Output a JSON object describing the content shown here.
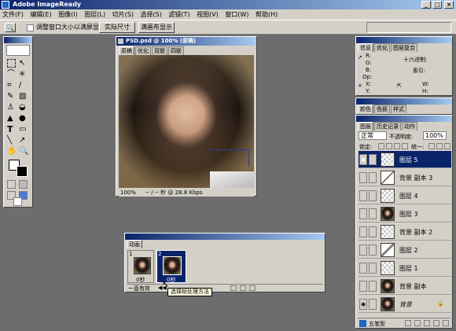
{
  "app": {
    "title": "Adobe ImageReady"
  },
  "window_buttons": [
    "_",
    "□",
    "×"
  ],
  "menu": [
    "文件(F)",
    "编辑(E)",
    "图像(I)",
    "图层(L)",
    "切片(S)",
    "选择(S)",
    "滤镜(T)",
    "视图(V)",
    "窗口(W)",
    "帮助(H)"
  ],
  "options": {
    "checkbox_label": "调整窗口大小以满屏显示",
    "actual_size": "实际尺寸",
    "fit_screen": "满画布显示"
  },
  "doc": {
    "title": "PSD.psd @ 100% (原稿)",
    "tabs": [
      "原稿",
      "优化",
      "双联",
      "四联"
    ],
    "zoom": "100%",
    "status": "-- / -- 秒 @ 28.8 Kbps"
  },
  "info_panel": {
    "tabs": [
      "信息",
      "优化",
      "图层复合"
    ],
    "r": "R:",
    "g": "G:",
    "b": "B:",
    "op": "Op:",
    "hex_label": "十六进制:",
    "index_label": "索引:",
    "x": "X:",
    "y": "Y:",
    "w": "W:",
    "h": "H:"
  },
  "color_panel": {
    "tabs": [
      "颜色",
      "色板",
      "样式"
    ]
  },
  "layers_panel": {
    "tabs": [
      "图层",
      "历史记录",
      "动作"
    ],
    "blend_mode": "正常",
    "opacity_label": "不透明度:",
    "opacity": "100%",
    "lock_label": "锁定:",
    "unify_label": "统一:",
    "layers": [
      {
        "name": "图层 5",
        "selected": true,
        "visible": true,
        "thumb": "checker"
      },
      {
        "name": "背景 副本 3",
        "selected": false,
        "visible": false,
        "thumb": "brush"
      },
      {
        "name": "图层 4",
        "selected": false,
        "visible": false,
        "thumb": "checker"
      },
      {
        "name": "图层 3",
        "selected": false,
        "visible": false,
        "thumb": "portrait"
      },
      {
        "name": "背景 副本 2",
        "selected": false,
        "visible": false,
        "thumb": "checker"
      },
      {
        "name": "图层 2",
        "selected": false,
        "visible": false,
        "thumb": "stroke"
      },
      {
        "name": "图层 1",
        "selected": false,
        "visible": false,
        "thumb": "checker"
      },
      {
        "name": "背景 副本",
        "selected": false,
        "visible": false,
        "thumb": "portrait"
      },
      {
        "name": "背景",
        "selected": false,
        "visible": true,
        "thumb": "portrait"
      }
    ],
    "footer_label": "五笔型"
  },
  "animation": {
    "title": "动画",
    "frames": [
      {
        "num": "1",
        "delay": "0秒"
      },
      {
        "num": "2",
        "delay": "0秒"
      }
    ],
    "loop": "一直有效",
    "tooltip": "选择帧处理方法"
  },
  "colors": {
    "titlebar": "#0a246a",
    "panel": "#d4d0c8",
    "workspace": "#6d6d6d",
    "selection": "#0a246a"
  }
}
